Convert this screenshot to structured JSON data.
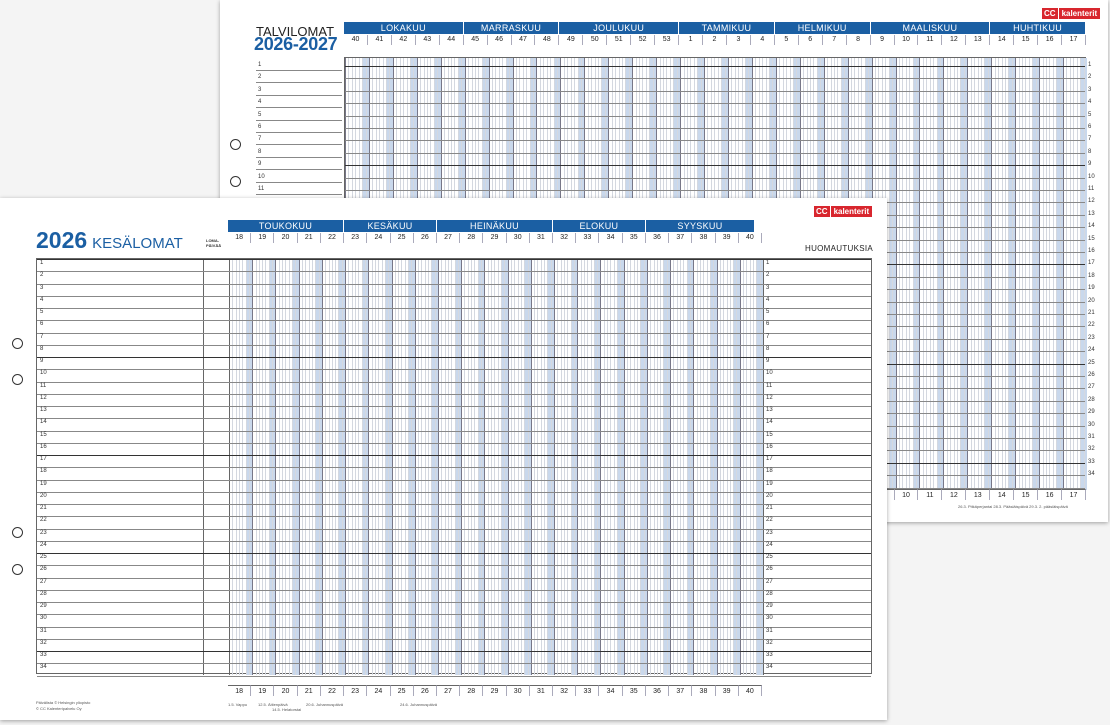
{
  "back_sheet": {
    "title_small": "TALVILOMAT",
    "title_big": "2026-2027",
    "logo_cc": "CC",
    "logo_text": "kalenterit",
    "months": [
      "LOKAKUU",
      "MARRASKUU",
      "JOULUKUU",
      "TAMMIKUU",
      "HELMIKUU",
      "MAALISKUU",
      "HUHTIKUU"
    ],
    "weeks": [
      "40",
      "41",
      "42",
      "43",
      "44",
      "45",
      "46",
      "47",
      "48",
      "49",
      "50",
      "51",
      "52",
      "53",
      "1",
      "2",
      "3",
      "4",
      "5",
      "6",
      "7",
      "8",
      "9",
      "10",
      "11",
      "12",
      "13",
      "14",
      "15",
      "16",
      "17"
    ],
    "bottom_weeks": [
      "9",
      "10",
      "11",
      "12",
      "13",
      "14",
      "15",
      "16",
      "17"
    ],
    "rows_left": [
      "1",
      "2",
      "3",
      "4",
      "5",
      "6",
      "7",
      "8",
      "9",
      "10",
      "11"
    ],
    "rows_right": [
      "1",
      "2",
      "3",
      "4",
      "5",
      "6",
      "7",
      "8",
      "9",
      "10",
      "11",
      "12",
      "13",
      "14",
      "15",
      "16",
      "17",
      "18",
      "19",
      "20",
      "21",
      "22",
      "23",
      "24",
      "25",
      "26",
      "27",
      "28",
      "29",
      "30",
      "31",
      "32",
      "33",
      "34"
    ],
    "footnote": "26.3. Pitkäperjantai  28.3. Pääsiäispäivä  29.3. 2. pääsiäispäivä"
  },
  "front_sheet": {
    "title_year": "2026",
    "title_word": "KESÄLOMAT",
    "col_label": "LOMA-PÄIVÄÄ",
    "logo_cc": "CC",
    "logo_text": "kalenterit",
    "notes_title": "HUOMAUTUKSIA",
    "months": [
      "TOUKOKUU",
      "KESÄKUU",
      "HEINÄKUU",
      "ELOKUU",
      "SYYSKUU"
    ],
    "weeks": [
      "18",
      "19",
      "20",
      "21",
      "22",
      "23",
      "24",
      "25",
      "26",
      "27",
      "28",
      "29",
      "30",
      "31",
      "32",
      "33",
      "34",
      "35",
      "36",
      "37",
      "38",
      "39",
      "40"
    ],
    "rows": [
      "1",
      "2",
      "3",
      "4",
      "5",
      "6",
      "7",
      "8",
      "9",
      "10",
      "11",
      "12",
      "13",
      "14",
      "15",
      "16",
      "17",
      "18",
      "19",
      "20",
      "21",
      "22",
      "23",
      "24",
      "25",
      "26",
      "27",
      "28",
      "29",
      "30",
      "31",
      "32",
      "33",
      "34"
    ],
    "footer_left_1": "Päivälista © Helsingin yliopisto",
    "footer_left_2": "© CC Kalenteripalvelu Oy",
    "footer_holidays": [
      "1.5. Vappu",
      "12.5. Äitienpäivä",
      "14.5. Helatorstai",
      "20.6. Juhannuspäivä",
      "24.6. Juhannuspäivä"
    ]
  },
  "colors": {
    "accent": "#1b5fa3",
    "logo_red": "#d8262e",
    "weekend_shade": "#c9d8ec"
  }
}
